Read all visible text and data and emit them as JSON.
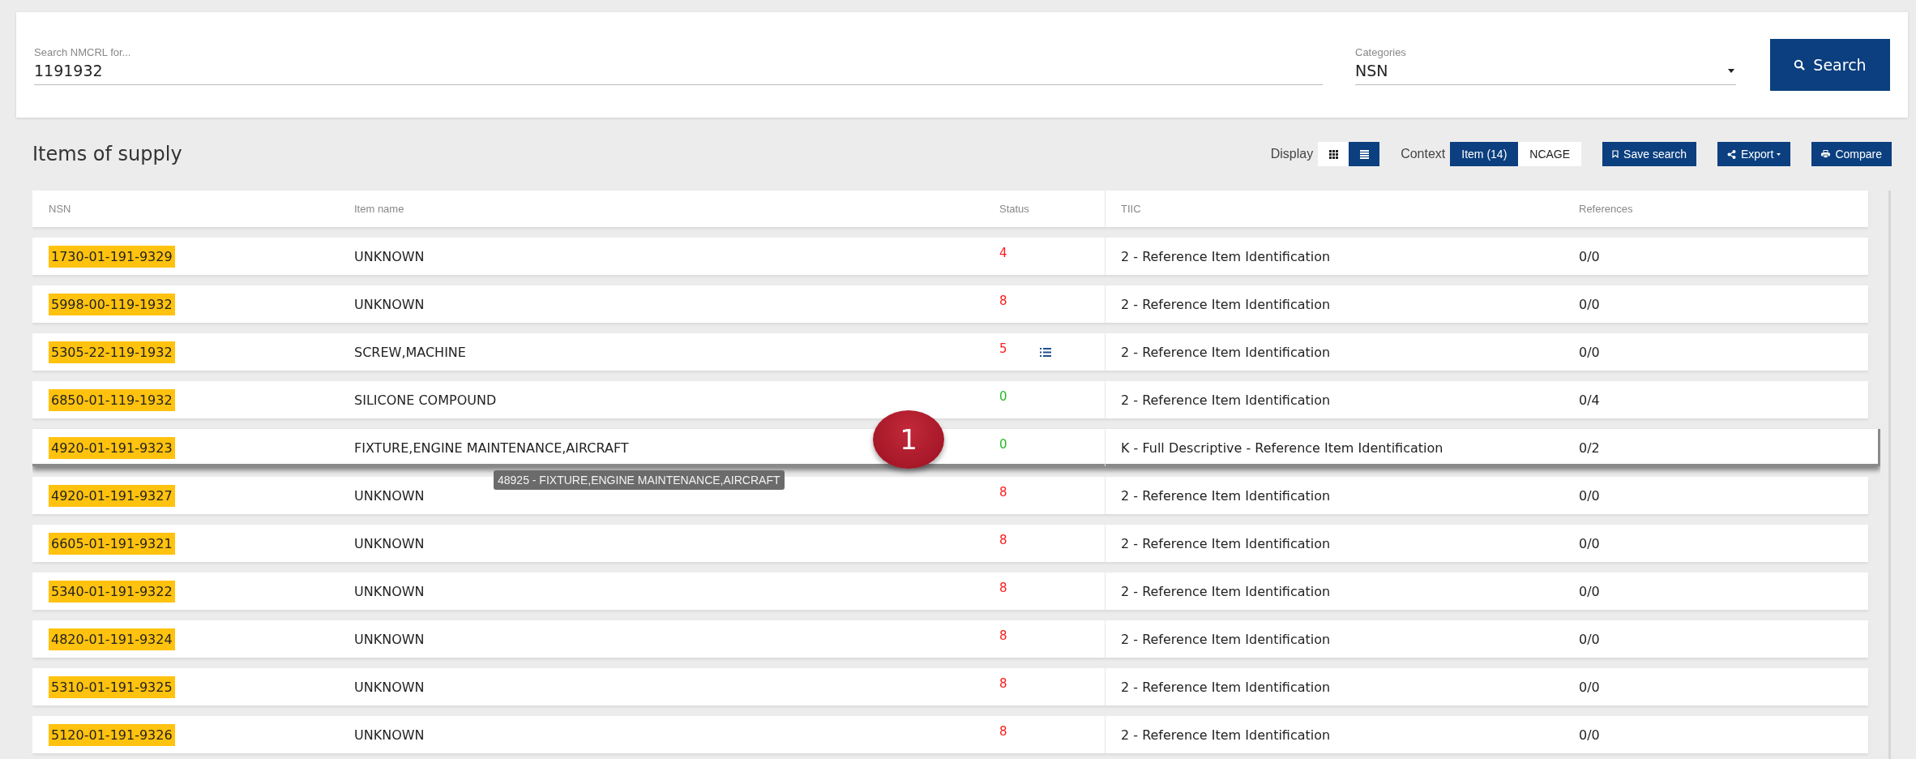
{
  "search": {
    "label": "Search NMCRL for...",
    "value": "1191932"
  },
  "categories": {
    "label": "Categories",
    "value": "NSN"
  },
  "search_button": {
    "label": "Search"
  },
  "section_title": "Items of supply",
  "display": {
    "label": "Display",
    "options": [
      {
        "kind": "grid",
        "selected": false
      },
      {
        "kind": "list",
        "selected": true
      }
    ]
  },
  "context": {
    "label": "Context",
    "tabs": [
      {
        "label": "Item (14)",
        "selected": true
      },
      {
        "label": "NCAGE",
        "selected": false
      }
    ]
  },
  "actions": [
    {
      "kind": "bookmark",
      "label": "Save search"
    },
    {
      "kind": "share",
      "label": "Export",
      "dropdown": true
    },
    {
      "kind": "print",
      "label": "Compare",
      "dropdown": false
    }
  ],
  "table": {
    "columns": [
      "NSN",
      "Item name",
      "Status",
      "TIIC",
      "References"
    ],
    "rows": [
      {
        "nsn": "1730-01-191-9329",
        "item_name": "UNKNOWN",
        "status": "4",
        "color": "#ff1a1a",
        "details": false,
        "tiic": "2 - Reference Item Identification",
        "references": "0/0",
        "selected": false
      },
      {
        "nsn": "5998-00-119-1932",
        "item_name": "UNKNOWN",
        "status": "8",
        "color": "#ff1a1a",
        "details": false,
        "tiic": "2 - Reference Item Identification",
        "references": "0/0",
        "selected": false
      },
      {
        "nsn": "5305-22-119-1932",
        "item_name": "SCREW,MACHINE",
        "status": "5",
        "color": "#ff1a1a",
        "details": true,
        "tiic": "2 - Reference Item Identification",
        "references": "0/0",
        "selected": false
      },
      {
        "nsn": "6850-01-119-1932",
        "item_name": "SILICONE COMPOUND",
        "status": "0",
        "color": "#22bb22",
        "details": false,
        "tiic": "2 - Reference Item Identification",
        "references": "0/4",
        "selected": false
      },
      {
        "nsn": "4920-01-191-9323",
        "item_name": "FIXTURE,ENGINE MAINTENANCE,AIRCRAFT",
        "status": "0",
        "color": "#22bb22",
        "details": false,
        "tiic": "K - Full Descriptive - Reference Item Identification",
        "references": "0/2",
        "selected": true,
        "tooltip": "48925 - FIXTURE,ENGINE MAINTENANCE,AIRCRAFT"
      },
      {
        "nsn": "4920-01-191-9327",
        "item_name": "UNKNOWN",
        "status": "8",
        "color": "#ff1a1a",
        "details": false,
        "tiic": "2 - Reference Item Identification",
        "references": "0/0",
        "selected": false
      },
      {
        "nsn": "6605-01-191-9321",
        "item_name": "UNKNOWN",
        "status": "8",
        "color": "#ff1a1a",
        "details": false,
        "tiic": "2 - Reference Item Identification",
        "references": "0/0",
        "selected": false
      },
      {
        "nsn": "5340-01-191-9322",
        "item_name": "UNKNOWN",
        "status": "8",
        "color": "#ff1a1a",
        "details": false,
        "tiic": "2 - Reference Item Identification",
        "references": "0/0",
        "selected": false
      },
      {
        "nsn": "4820-01-191-9324",
        "item_name": "UNKNOWN",
        "status": "8",
        "color": "#ff1a1a",
        "details": false,
        "tiic": "2 - Reference Item Identification",
        "references": "0/0",
        "selected": false
      },
      {
        "nsn": "5310-01-191-9325",
        "item_name": "UNKNOWN",
        "status": "8",
        "color": "#ff1a1a",
        "details": false,
        "tiic": "2 - Reference Item Identification",
        "references": "0/0",
        "selected": false
      },
      {
        "nsn": "5120-01-191-9326",
        "item_name": "UNKNOWN",
        "status": "8",
        "color": "#ff1a1a",
        "details": false,
        "tiic": "2 - Reference Item Identification",
        "references": "0/0",
        "selected": false
      }
    ]
  },
  "callout": {
    "label": "1"
  }
}
